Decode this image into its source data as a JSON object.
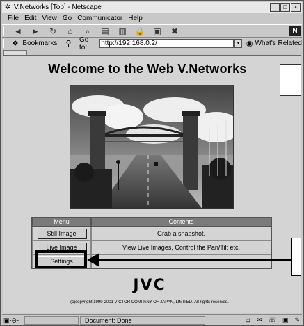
{
  "window": {
    "title": "V.Networks [Top] - Netscape",
    "controls": [
      "_",
      "□",
      "×"
    ]
  },
  "menubar": {
    "items": [
      "File",
      "Edit",
      "View",
      "Go",
      "Communicator",
      "Help"
    ]
  },
  "toolbar": {
    "icons": [
      "back-icon",
      "forward-icon",
      "reload-icon",
      "home-icon",
      "search-icon",
      "guide-icon",
      "print-icon",
      "security-icon",
      "shop-icon",
      "stop-icon"
    ]
  },
  "location": {
    "bookmarks_label": "Bookmarks",
    "goto_label": "Go to:",
    "url": "http://192.168.0.2/",
    "related_label": "What's Related"
  },
  "page": {
    "heading": "Welcome to the Web V.Networks",
    "menu_table": {
      "headers": [
        "Menu",
        "Contents"
      ],
      "rows": [
        {
          "button": "Still Image",
          "contents": "Grab a snapshot."
        },
        {
          "button": "Live Image",
          "contents": "View Live Images, Control the Pan/Tilt etc."
        },
        {
          "button": "Settings",
          "contents": ""
        }
      ]
    },
    "logo": "JVC",
    "copyright": "(c)copyright 1999-2001 VICTOR COMPANY OF JAPAN, LIMITED. All rights reserved."
  },
  "status": {
    "text": "Document: Done"
  }
}
